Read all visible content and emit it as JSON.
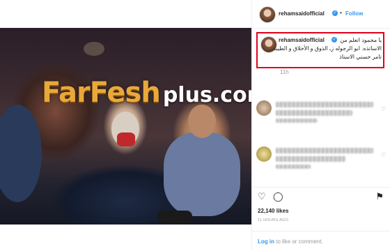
{
  "watermark": {
    "main": "FarFesh",
    "sub": "plus.com",
    "plus_icon": "+"
  },
  "header": {
    "username": "rehamsaidofficial",
    "verified_icon": "✓",
    "separator": "•",
    "follow_label": "Follow"
  },
  "caption": {
    "username": "rehamsaidofficial",
    "lines": [
      "يا محمود اتعلم من",
      "الاساتذه. ابو الرجوله زـ الذوق و الأخلاق و الطيبه .",
      "تامر حسني الاستاذ"
    ],
    "time": "11h"
  },
  "comments": [
    {
      "heart_icon": "♡"
    },
    {
      "heart_icon": "♡"
    }
  ],
  "actions": {
    "like_icon": "♡",
    "comment_icon": "◯",
    "bookmark_icon": "⚑"
  },
  "likes": "22,140 likes",
  "posted_ago": "11 HOURS AGO",
  "footer": {
    "login_link": "Log in",
    "login_rest": "to like or comment."
  }
}
